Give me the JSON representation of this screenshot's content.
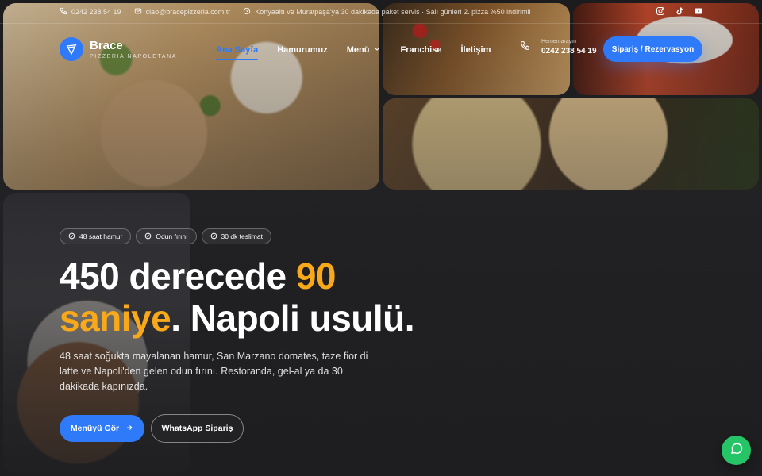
{
  "topbar": {
    "phone": "0242 238 54 19",
    "email": "ciao@bracepizzeria.com.tr",
    "notice": "Konyaaltı ve Muratpaşa'ya 30 dakikada paket servis · Salı günleri 2. pizza %50 indirimli"
  },
  "social": [
    "instagram-icon",
    "tiktok-icon",
    "youtube-icon"
  ],
  "brand": {
    "name": "Brace",
    "tagline": "PIZZERIA NAPOLETANA"
  },
  "nav": {
    "items": [
      {
        "label": "Ana Sayfa",
        "active": true
      },
      {
        "label": "Hamurumuz"
      },
      {
        "label": "Menü",
        "dropdown": true
      },
      {
        "label": "Franchise"
      },
      {
        "label": "İletişim"
      }
    ]
  },
  "contact": {
    "label": "Hemen arayın",
    "phone": "0242 238 54 19"
  },
  "cta": {
    "label": "Sipariş / Rezervasyon"
  },
  "hero": {
    "badges": [
      "48 saat hamur",
      "Odun fırını",
      "30 dk teslimat"
    ],
    "headline_1": "450 derecede ",
    "headline_accent_1": "90",
    "headline_accent_2": "saniye",
    "headline_2": ". Napoli usulü.",
    "description": "48 saat soğukta mayalanan hamur, San Marzano domates, taze fior di latte ve Napoli'den gelen odun fırını. Restoranda, gel-al ya da 30 dakikada kapınızda.",
    "primary_button": "Menüyü Gör",
    "secondary_button": "WhatsApp Sipariş"
  },
  "colors": {
    "accent": "#2f7af8",
    "highlight": "#f7a81b",
    "whatsapp": "#25c466"
  }
}
